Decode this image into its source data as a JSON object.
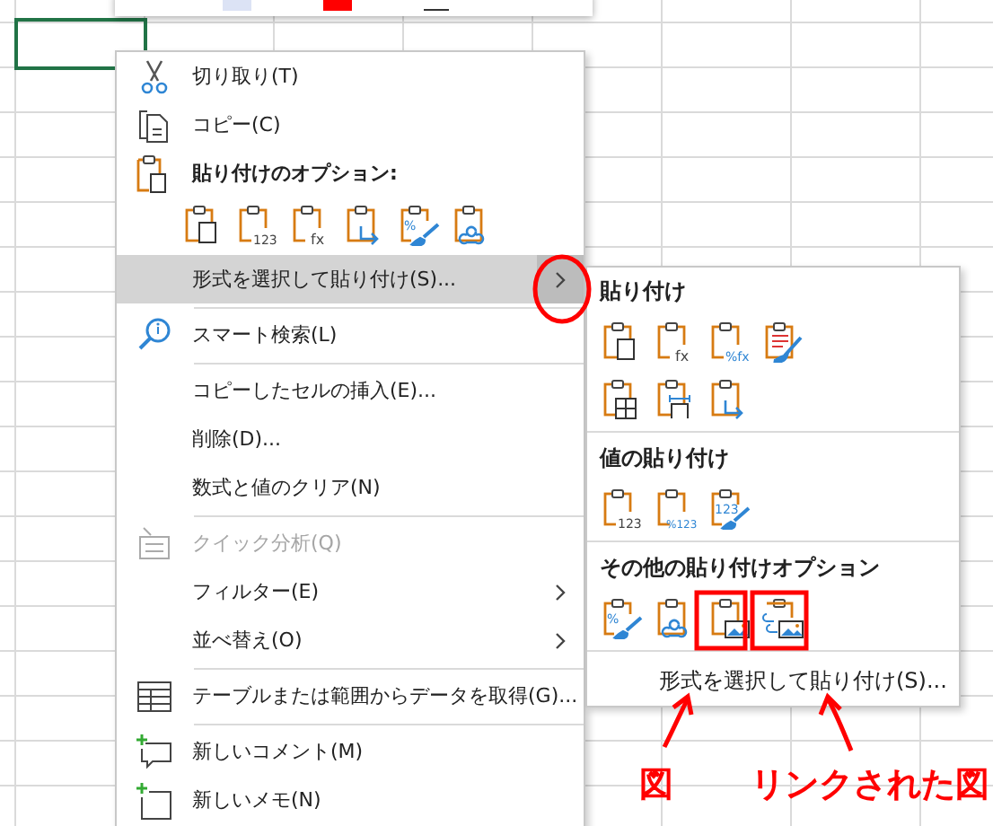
{
  "context_menu": {
    "items": [
      {
        "kind": "item",
        "label": "切り取り(T)",
        "selected": false,
        "disabled": false,
        "submenu": false
      },
      {
        "kind": "item",
        "label": "コピー(C)",
        "selected": false,
        "disabled": false,
        "submenu": false
      },
      {
        "kind": "header",
        "label": "貼り付けのオプション:"
      },
      {
        "kind": "icons",
        "icons": [
          {
            "kind": "keep"
          },
          {
            "kind": "badge",
            "badge": "123"
          },
          {
            "kind": "badge",
            "badge": "fx"
          },
          {
            "kind": "transpose"
          },
          {
            "kind": "brush",
            "badge": "%"
          },
          {
            "kind": "link"
          }
        ]
      },
      {
        "kind": "item",
        "label": "形式を選択して貼り付け(S)...",
        "selected": true,
        "disabled": false,
        "submenu": true
      },
      {
        "kind": "separator"
      },
      {
        "kind": "item",
        "label": "スマート検索(L)",
        "selected": false,
        "disabled": false,
        "submenu": false
      },
      {
        "kind": "separator"
      },
      {
        "kind": "item",
        "label": "コピーしたセルの挿入(E)...",
        "selected": false,
        "disabled": false,
        "submenu": false
      },
      {
        "kind": "item",
        "label": "削除(D)...",
        "selected": false,
        "disabled": false,
        "submenu": false
      },
      {
        "kind": "item",
        "label": "数式と値のクリア(N)",
        "selected": false,
        "disabled": false,
        "submenu": false
      },
      {
        "kind": "separator"
      },
      {
        "kind": "item",
        "label": "クイック分析(Q)",
        "selected": false,
        "disabled": true,
        "submenu": false
      },
      {
        "kind": "item",
        "label": "フィルター(E)",
        "selected": false,
        "disabled": false,
        "submenu": true
      },
      {
        "kind": "item",
        "label": "並べ替え(O)",
        "selected": false,
        "disabled": false,
        "submenu": true
      },
      {
        "kind": "separator"
      },
      {
        "kind": "item",
        "label": "テーブルまたは範囲からデータを取得(G)...",
        "selected": false,
        "disabled": false,
        "submenu": false
      },
      {
        "kind": "separator"
      },
      {
        "kind": "item",
        "label": "新しいコメント(M)",
        "selected": false,
        "disabled": false,
        "submenu": false
      },
      {
        "kind": "item",
        "label": "新しいメモ(N)",
        "selected": false,
        "disabled": false,
        "submenu": false
      }
    ]
  },
  "paste_special_submenu": {
    "sections": [
      {
        "title": "貼り付け",
        "rows": [
          [
            {
              "kind": "keep"
            },
            {
              "kind": "badge",
              "badge": "fx"
            },
            {
              "kind": "badge",
              "badge": "%fx"
            },
            {
              "kind": "format"
            }
          ],
          [
            {
              "kind": "grid"
            },
            {
              "kind": "width"
            },
            {
              "kind": "transpose"
            }
          ]
        ]
      },
      {
        "title": "値の貼り付け",
        "rows": [
          [
            {
              "kind": "badge",
              "badge": "123"
            },
            {
              "kind": "badge",
              "badge": "%123"
            },
            {
              "kind": "brush",
              "badge": "123"
            }
          ]
        ]
      },
      {
        "title": "その他の貼り付けオプション",
        "rows": [
          [
            {
              "kind": "brush",
              "badge": "%"
            },
            {
              "kind": "link"
            },
            {
              "kind": "picture"
            },
            {
              "kind": "linked-picture"
            }
          ]
        ]
      }
    ],
    "footer": "形式を選択して貼り付け(S)..."
  },
  "annotations": [
    {
      "label": "図"
    },
    {
      "label": "リンクされた図"
    }
  ]
}
